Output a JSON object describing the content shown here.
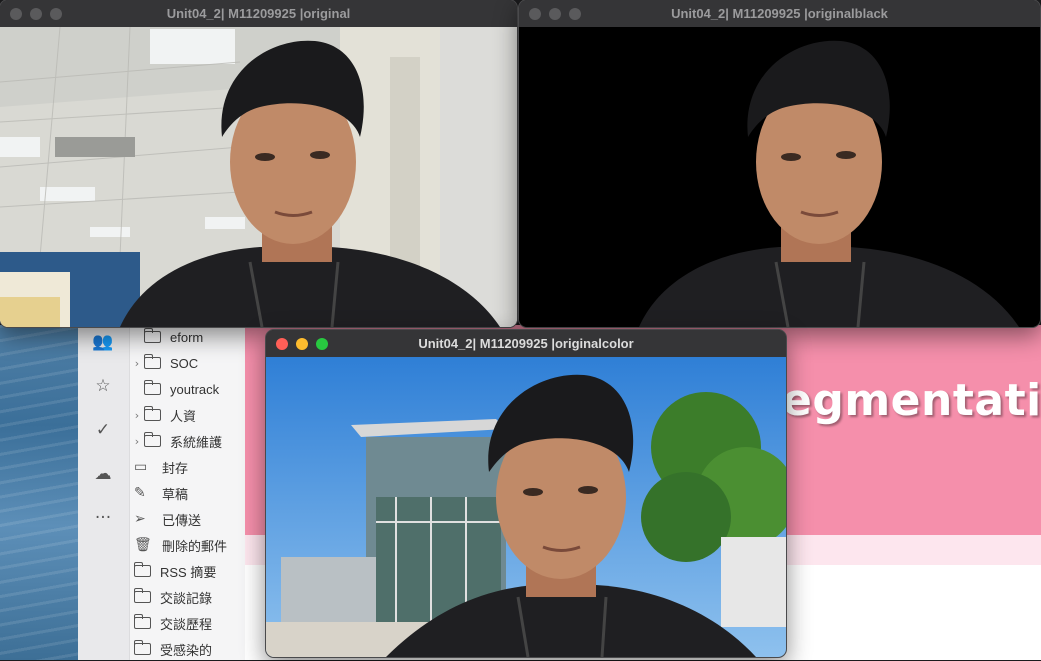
{
  "windows": {
    "original": {
      "title": "Unit04_2| M11209925 |original"
    },
    "original_black": {
      "title": "Unit04_2| M11209925 |originalblack"
    },
    "original_color": {
      "title": "Unit04_2| M11209925 |originalcolor"
    }
  },
  "mail": {
    "rail_icons": [
      "contacts-icon",
      "star-icon",
      "checkmark-icon",
      "cloud-icon",
      "more-icon"
    ],
    "folders": [
      {
        "label": "eform",
        "chevron": false,
        "icon": "folder-icon"
      },
      {
        "label": "SOC",
        "chevron": true,
        "icon": "folder-icon"
      },
      {
        "label": "youtrack",
        "chevron": false,
        "icon": "folder-icon"
      },
      {
        "label": "人資",
        "chevron": true,
        "icon": "folder-icon"
      },
      {
        "label": "系統維護",
        "chevron": true,
        "icon": "folder-icon"
      },
      {
        "label": "封存",
        "chevron": false,
        "icon": "archive-icon"
      },
      {
        "label": "草稿",
        "chevron": false,
        "icon": "draft-icon"
      },
      {
        "label": "已傳送",
        "chevron": false,
        "icon": "sent-icon"
      },
      {
        "label": "刪除的郵件",
        "chevron": false,
        "icon": "trash-icon"
      },
      {
        "label": "RSS 摘要",
        "chevron": false,
        "icon": "folder-icon"
      },
      {
        "label": "交談記錄",
        "chevron": false,
        "icon": "folder-icon"
      },
      {
        "label": "交談歷程",
        "chevron": false,
        "icon": "folder-icon"
      },
      {
        "label": "受感染的",
        "chevron": false,
        "icon": "folder-icon"
      }
    ]
  },
  "webpage": {
    "heading": "egmentatio"
  },
  "colors": {
    "banner": "#f58fab",
    "close": "#ff5f57",
    "minimize": "#febc2e",
    "maximize": "#28c840"
  }
}
